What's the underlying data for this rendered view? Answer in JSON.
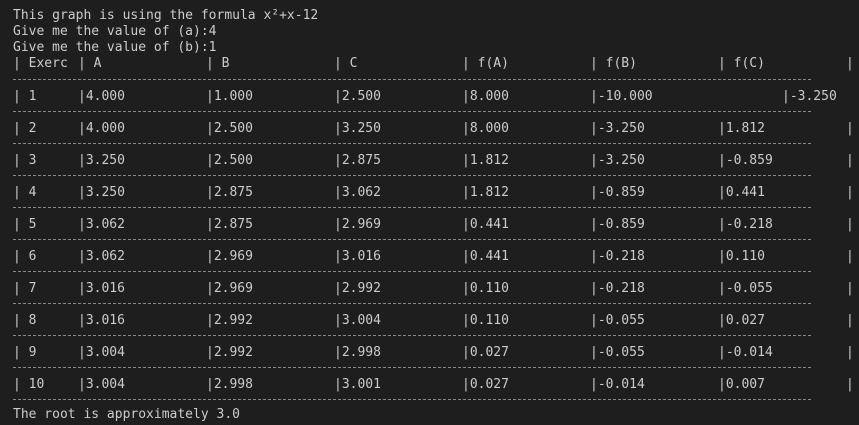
{
  "intro": [
    "This graph is using the formula x²+x-12",
    "Give me the value of (a):4",
    "Give me the value of (b):1"
  ],
  "table": {
    "headers": [
      "| Exerc",
      "| A",
      "| B",
      "| C",
      "| f(A)",
      "| f(B)",
      "| f(C)",
      "|"
    ],
    "rows": [
      [
        "| 1",
        "|4.000",
        "|1.000",
        "|2.500",
        "|8.000",
        "|-10.000",
        "",
        "|-3.250"
      ],
      [
        "| 2",
        "|4.000",
        "|2.500",
        "|3.250",
        "|8.000",
        "|-3.250",
        "|1.812",
        "|"
      ],
      [
        "| 3",
        "|3.250",
        "|2.500",
        "|2.875",
        "|1.812",
        "|-3.250",
        "|-0.859",
        "|"
      ],
      [
        "| 4",
        "|3.250",
        "|2.875",
        "|3.062",
        "|1.812",
        "|-0.859",
        "|0.441",
        "|"
      ],
      [
        "| 5",
        "|3.062",
        "|2.875",
        "|2.969",
        "|0.441",
        "|-0.859",
        "|-0.218",
        "|"
      ],
      [
        "| 6",
        "|3.062",
        "|2.969",
        "|3.016",
        "|0.441",
        "|-0.218",
        "|0.110",
        "|"
      ],
      [
        "| 7",
        "|3.016",
        "|2.969",
        "|2.992",
        "|0.110",
        "|-0.218",
        "|-0.055",
        "|"
      ],
      [
        "| 8",
        "|3.016",
        "|2.992",
        "|3.004",
        "|0.110",
        "|-0.055",
        "|0.027",
        "|"
      ],
      [
        "| 9",
        "|3.004",
        "|2.992",
        "|2.998",
        "|0.027",
        "|-0.055",
        "|-0.014",
        "|"
      ],
      [
        "| 10",
        "|3.004",
        "|2.998",
        "|3.001",
        "|0.027",
        "|-0.014",
        "|0.007",
        "|"
      ]
    ]
  },
  "result": "The root is approximately 3.0"
}
